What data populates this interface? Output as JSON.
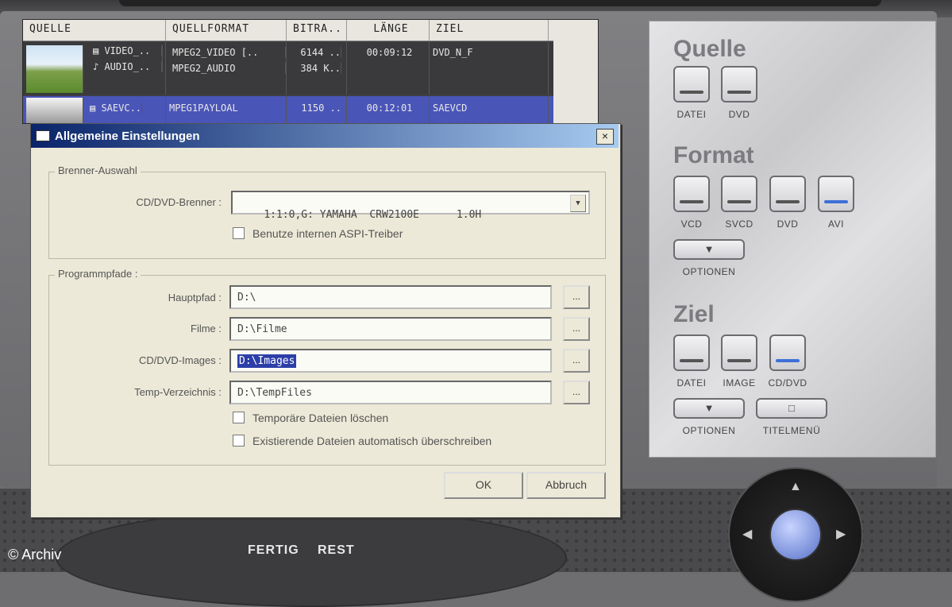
{
  "watermark": "© Archiv",
  "filelist": {
    "columns": [
      "QUELLE",
      "QUELLFORMAT",
      "BITRA..",
      "LÄNGE",
      "ZIEL"
    ],
    "rows": [
      {
        "source_line1": "VIDEO_..",
        "source_line2": "AUDIO_..",
        "format_line1": "MPEG2_VIDEO [..",
        "format_line2": "MPEG2_AUDIO",
        "bitrate_line1": "6144 ..",
        "bitrate_line2": "384 K..",
        "length": "00:09:12",
        "target": "DVD_N_F"
      },
      {
        "source_line1": "SAEVC..",
        "format_line1": "MPEG1PAYLOAL",
        "bitrate_line1": "1150 ..",
        "length": "00:12:01",
        "target": "SAEVCD"
      }
    ]
  },
  "panel": {
    "quelle": {
      "title": "Quelle",
      "buttons": [
        {
          "label": "DATEI",
          "active": false
        },
        {
          "label": "DVD",
          "active": false
        }
      ]
    },
    "format": {
      "title": "Format",
      "buttons": [
        {
          "label": "VCD",
          "active": false
        },
        {
          "label": "SVCD",
          "active": false
        },
        {
          "label": "DVD",
          "active": false
        },
        {
          "label": "AVI",
          "active": true
        }
      ],
      "options_label": "OPTIONEN"
    },
    "ziel": {
      "title": "Ziel",
      "buttons": [
        {
          "label": "DATEI",
          "active": false
        },
        {
          "label": "IMAGE",
          "active": false
        },
        {
          "label": "CD/DVD",
          "active": true
        }
      ],
      "options_label": "OPTIONEN",
      "menu_label": "TITELMENÜ"
    }
  },
  "bottom": {
    "fertig": "FERTIG",
    "rest": "REST"
  },
  "dialog": {
    "title": "Allgemeine Einstellungen",
    "close": "×",
    "brenner_group": "Brenner-Auswahl",
    "brenner_label": "CD/DVD-Brenner :",
    "brenner_value": "1:1:0,G: YAMAHA  CRW2100E      1.0H",
    "aspi_label": "Benutze internen ASPI-Treiber",
    "pfade_group": "Programmpfade :",
    "hauptpfad_label": "Hauptpfad :",
    "hauptpfad_value": "D:\\",
    "filme_label": "Filme :",
    "filme_value": "D:\\Filme",
    "images_label": "CD/DVD-Images :",
    "images_value": "D:\\Images",
    "temp_label": "Temp-Verzeichnis :",
    "temp_value": "D:\\TempFiles",
    "browse": "...",
    "temp_delete_label": "Temporäre Dateien löschen",
    "overwrite_label": "Existierende Dateien automatisch überschreiben",
    "ok": "OK",
    "cancel": "Abbruch"
  }
}
